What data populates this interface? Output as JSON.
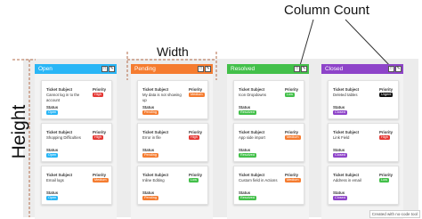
{
  "annotations": {
    "column_count": "Column Count",
    "width": "Width",
    "height": "Height"
  },
  "labels": {
    "subject": "Ticket Subject",
    "priority": "Priority",
    "status": "Status"
  },
  "colors": {
    "open": "#29b6f6",
    "pending": "#f57c30",
    "resolved": "#43c04a",
    "closed": "#8e44c9",
    "high": "#e53935",
    "medium": "#f57c30",
    "low": "#43c04a",
    "urgent": "#111111"
  },
  "columns": [
    {
      "title": "Open",
      "cards": [
        {
          "subject": "Cannot log in to the account",
          "priority": "High",
          "status": "Open"
        },
        {
          "subject": "Shopping Difficulties",
          "priority": "High",
          "status": "Open"
        },
        {
          "subject": "Email logs",
          "priority": "Medium",
          "status": "Open"
        }
      ]
    },
    {
      "title": "Pending",
      "cards": [
        {
          "subject": "My data is not showing up",
          "priority": "Medium",
          "status": "Pending"
        },
        {
          "subject": "Error in file",
          "priority": "High",
          "status": "Pending"
        },
        {
          "subject": "Inline Editing",
          "priority": "Low",
          "status": "Pending"
        }
      ]
    },
    {
      "title": "Resolved",
      "cards": [
        {
          "subject": "Icon Dropdowns",
          "priority": "Low",
          "status": "Resolved"
        },
        {
          "subject": "App side import",
          "priority": "Medium",
          "status": "Resolved"
        },
        {
          "subject": "Custom field in Actions",
          "priority": "Medium",
          "status": "Resolved"
        }
      ]
    },
    {
      "title": "Closed",
      "cards": [
        {
          "subject": "Deleted tables",
          "priority": "Urgent",
          "status": "Closed"
        },
        {
          "subject": "Link Field",
          "priority": "High",
          "status": "Closed"
        },
        {
          "subject": "Address in email",
          "priority": "Low",
          "status": "Closed"
        }
      ]
    }
  ],
  "watermark": "Created with no-code tool"
}
